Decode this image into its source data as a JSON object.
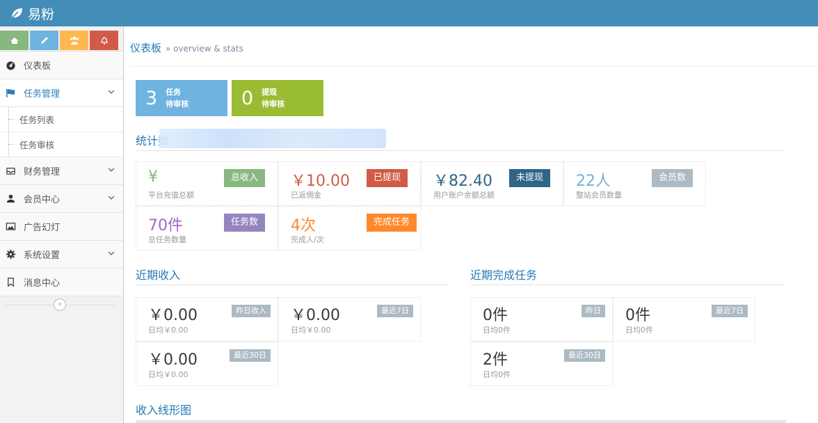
{
  "app": {
    "title": "易粉"
  },
  "shortcuts": [
    {
      "icon": "signal-icon",
      "color": "#87b87f"
    },
    {
      "icon": "pencil-icon",
      "color": "#6fb3e0"
    },
    {
      "icon": "users-icon",
      "color": "#ffb752"
    },
    {
      "icon": "bell-icon",
      "color": "#d15b47"
    }
  ],
  "sidebar": {
    "dashboard": "仪表板",
    "tasks": "任务管理",
    "task_list": "任务列表",
    "task_review": "任务审核",
    "finance": "财务管理",
    "members": "会员中心",
    "ads": "广告幻灯",
    "settings": "系统设置",
    "messages": "消息中心",
    "collapse": "«"
  },
  "breadcrumb": {
    "title": "仪表板",
    "subtitle": "» overview & stats"
  },
  "pending": [
    {
      "count": "3",
      "line1": "任务",
      "line2": "待审核"
    },
    {
      "count": "0",
      "line1": "提现",
      "line2": "待审核"
    }
  ],
  "sections": {
    "stats": "统计数",
    "recent_income": "近期收入",
    "recent_tasks": "近期完成任务",
    "income_chart": "收入线形图"
  },
  "stats": [
    {
      "value": "¥",
      "label": "平台充值总额",
      "tag": "总收入",
      "color": "#87b87f"
    },
    {
      "value": "￥10.00",
      "label": "已返佣金",
      "tag": "已提现",
      "color": "#d15b47"
    },
    {
      "value": "￥82.40",
      "label": "用户账户余额总额",
      "tag": "未提现",
      "color": "#2e6589"
    },
    {
      "value": "22人",
      "label": "整站会员数量",
      "tag": "会员数",
      "color": "#abbac3"
    },
    {
      "value": "70件",
      "label": "总任务数量",
      "tag": "任务数",
      "color": "#9585bf"
    },
    {
      "value": "4次",
      "label": "完成人/次",
      "tag": "完成任务",
      "color": "#ff892a"
    }
  ],
  "income": [
    {
      "value": "￥0.00",
      "sub": "日均￥0.00",
      "tag": "昨日收入"
    },
    {
      "value": "￥0.00",
      "sub": "日均￥0.00",
      "tag": "最近7日"
    },
    {
      "value": "￥0.00",
      "sub": "日均￥0.00",
      "tag": "最近30日"
    }
  ],
  "tasks_done": [
    {
      "value": "0件",
      "sub": "日均0件",
      "tag": "昨日"
    },
    {
      "value": "0件",
      "sub": "日均0件",
      "tag": "最近7日"
    },
    {
      "value": "2件",
      "sub": "日均0件",
      "tag": "最近30日"
    }
  ]
}
